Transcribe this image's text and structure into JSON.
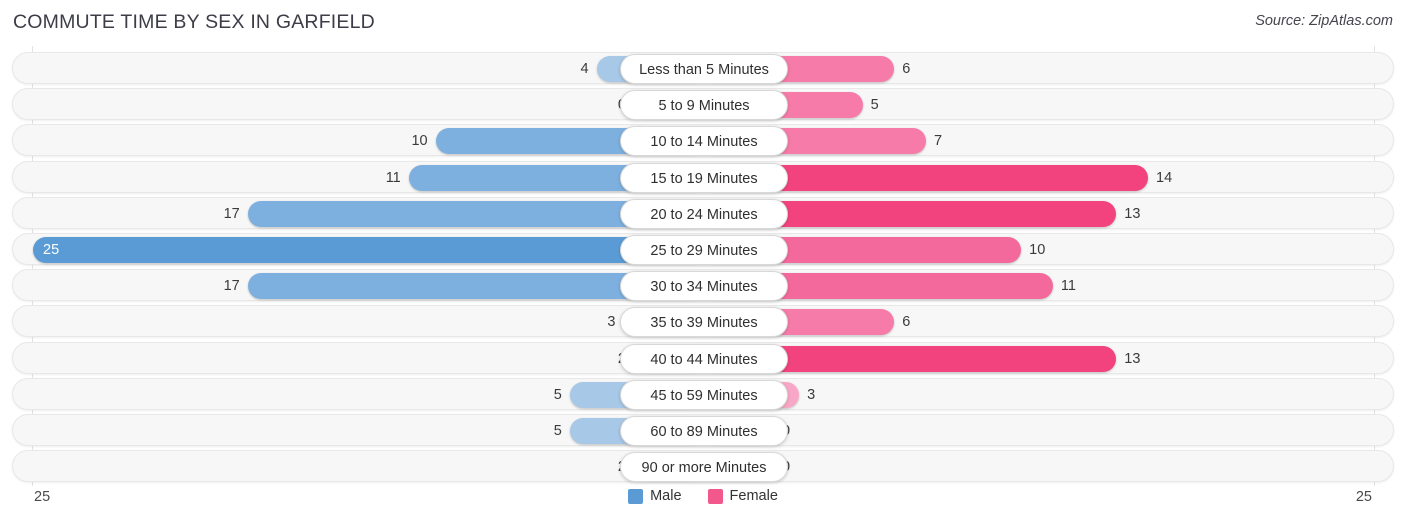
{
  "header": {
    "title": "COMMUTE TIME BY SEX IN GARFIELD",
    "source": "Source: ZipAtlas.com"
  },
  "axis": {
    "left_max_label": "25",
    "right_max_label": "25"
  },
  "legend": {
    "items": [
      {
        "label": "Male",
        "color": "#5b9bd5"
      },
      {
        "label": "Female",
        "color": "#f2588c"
      }
    ]
  },
  "colors": {
    "male_strong": "#5b9bd5",
    "male_mid": "#85b4e0",
    "male_light": "#a8c8e8",
    "female_strong": "#f2437f",
    "female_mid": "#f4699b",
    "female_light": "#f8a8c6",
    "row_track": "#f7f7f7",
    "gridline": "#e2e2e2"
  },
  "chart_data": {
    "type": "bar",
    "title": "COMMUTE TIME BY SEX IN GARFIELD",
    "subtitle": "Source: ZipAtlas.com",
    "orientation": "horizontal-diverging",
    "xlabel": "",
    "ylabel": "",
    "xlim": [
      25,
      25
    ],
    "grid": true,
    "legend_position": "bottom-center",
    "categories": [
      "Less than 5 Minutes",
      "5 to 9 Minutes",
      "10 to 14 Minutes",
      "15 to 19 Minutes",
      "20 to 24 Minutes",
      "25 to 29 Minutes",
      "30 to 34 Minutes",
      "35 to 39 Minutes",
      "40 to 44 Minutes",
      "45 to 59 Minutes",
      "60 to 89 Minutes",
      "90 or more Minutes"
    ],
    "series": [
      {
        "name": "Male",
        "values": [
          4,
          0,
          10,
          11,
          17,
          25,
          17,
          3,
          2,
          5,
          5,
          2
        ]
      },
      {
        "name": "Female",
        "values": [
          6,
          5,
          7,
          14,
          13,
          10,
          11,
          6,
          13,
          3,
          0,
          0
        ]
      }
    ],
    "value_labels": {
      "Male": [
        "4",
        "0",
        "10",
        "11",
        "17",
        "25",
        "17",
        "3",
        "2",
        "5",
        "5",
        "2"
      ],
      "Female": [
        "6",
        "5",
        "7",
        "14",
        "13",
        "10",
        "11",
        "6",
        "13",
        "3",
        "0",
        "0"
      ]
    }
  }
}
